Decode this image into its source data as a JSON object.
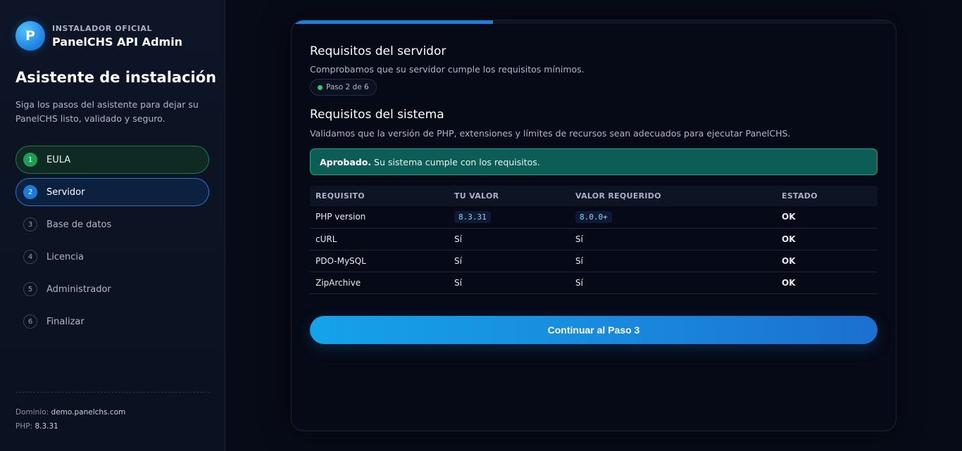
{
  "sidebar": {
    "brand_kicker": "INSTALADOR OFICIAL",
    "brand_name": "PanelCHS API Admin",
    "logo_letter": "P",
    "title": "Asistente de instalación",
    "description": "Siga los pasos del asistente para dejar su PanelCHS listo, validado y seguro.",
    "steps": [
      {
        "num": "1",
        "label": "EULA",
        "state": "done"
      },
      {
        "num": "2",
        "label": "Servidor",
        "state": "active"
      },
      {
        "num": "3",
        "label": "Base de datos",
        "state": "pending"
      },
      {
        "num": "4",
        "label": "Licencia",
        "state": "pending"
      },
      {
        "num": "5",
        "label": "Administrador",
        "state": "pending"
      },
      {
        "num": "6",
        "label": "Finalizar",
        "state": "pending"
      }
    ],
    "domain_label": "Dominio:",
    "domain_value": "demo.panelchs.com",
    "php_label": "PHP:",
    "php_value": "8.3.31"
  },
  "card": {
    "progress": 0.333,
    "server_title": "Requisitos del servidor",
    "server_desc": "Comprobamos que su servidor cumple los requisitos mínimos.",
    "step_badge": "Paso 2 de 6",
    "system_title": "Requisitos del sistema",
    "system_desc": "Validamos que la versión de PHP, extensiones y límites de recursos sean adecuados para ejecutar PanelCHS.",
    "alert_bold": "Aprobado.",
    "alert_text": "Su sistema cumple con los requisitos.",
    "table": {
      "headers": [
        "REQUISITO",
        "TU VALOR",
        "VALOR REQUERIDO",
        "ESTADO"
      ],
      "rows": [
        {
          "req": "PHP version",
          "value": "8.3.31",
          "required": "8.0.0+",
          "status": "OK"
        },
        {
          "req": "cURL",
          "value": "Sí",
          "required": "Sí",
          "status": "OK"
        },
        {
          "req": "PDO-MySQL",
          "value": "Sí",
          "required": "Sí",
          "status": "OK"
        },
        {
          "req": "ZipArchive",
          "value": "Sí",
          "required": "Sí",
          "status": "OK"
        }
      ]
    },
    "continue_label": "Continuar al Paso 3"
  },
  "colors": {
    "accent": "#1d7fe0",
    "success": "#3ddc6e",
    "alert_bg": "#0c5d55"
  }
}
